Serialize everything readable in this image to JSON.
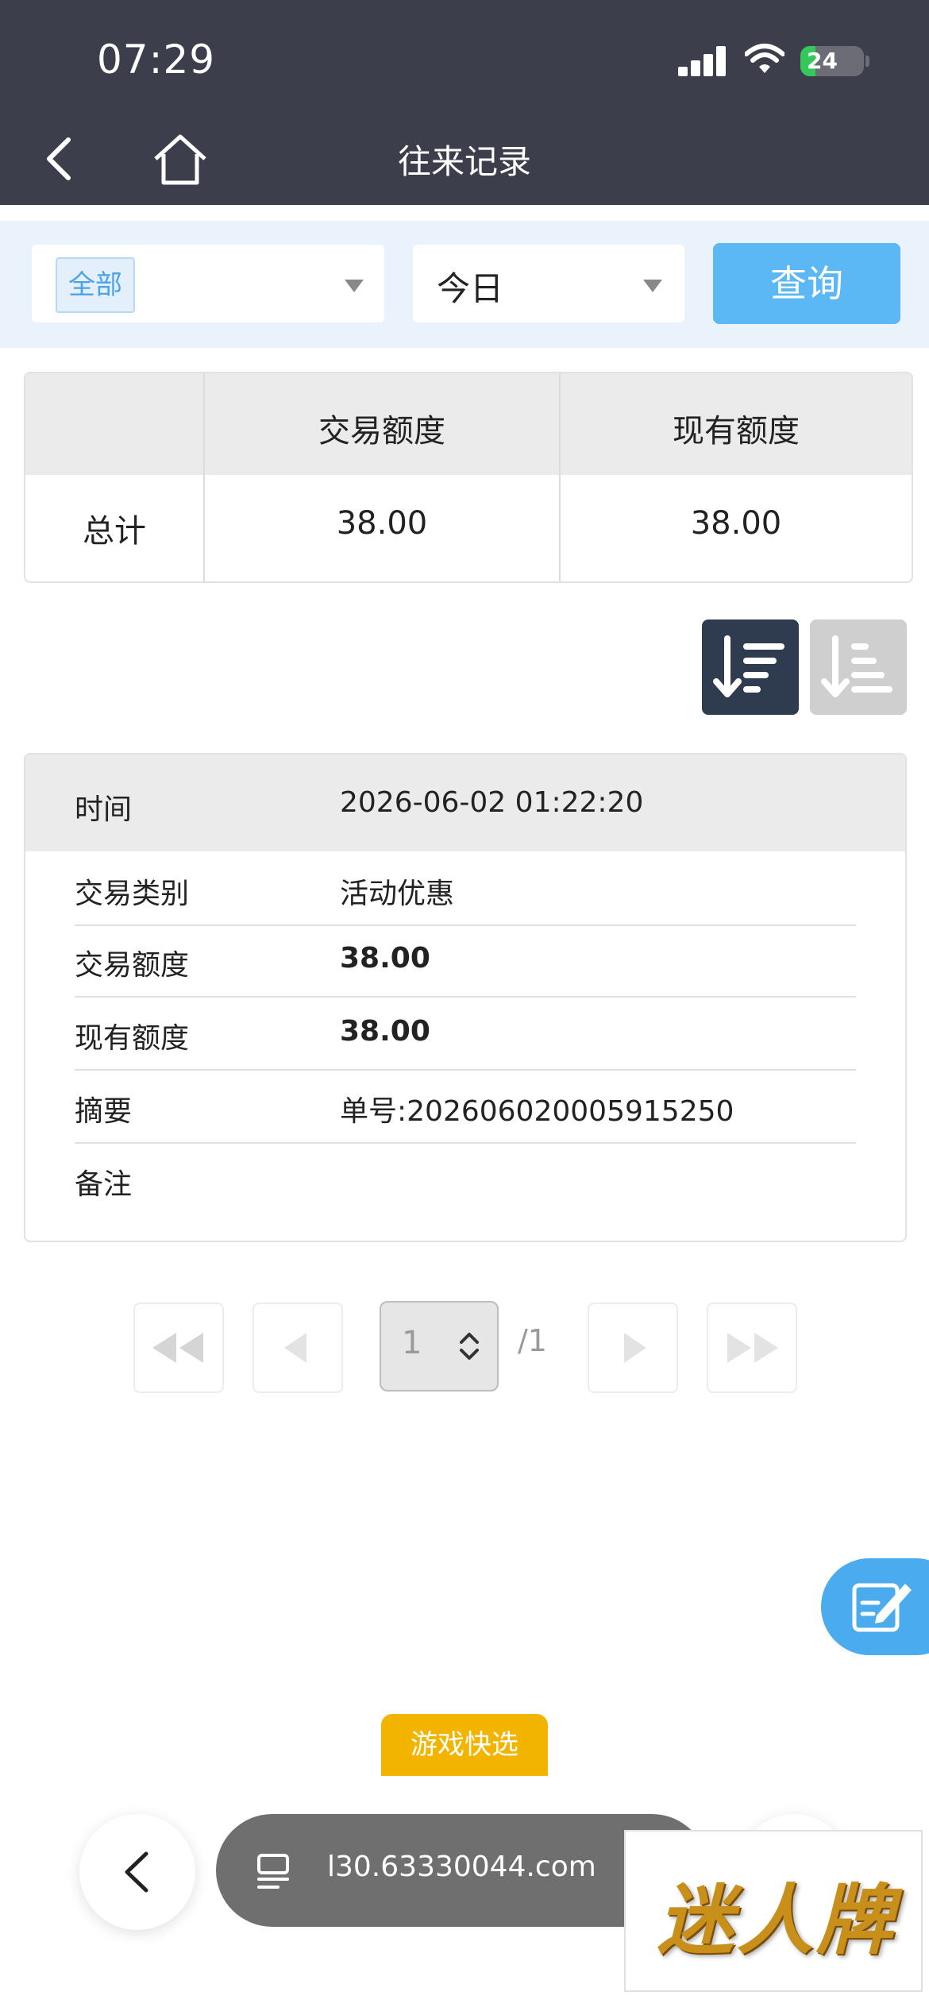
{
  "status_bar": {
    "time": "07:29",
    "battery": "24",
    "battery_level": 0.24
  },
  "nav": {
    "title": "往来记录",
    "back_icon": "chevron-left-icon",
    "home_icon": "home-icon"
  },
  "filters": {
    "category_selected": "全部",
    "period_selected": "今日",
    "query_label": "查询"
  },
  "summary": {
    "headers": [
      "",
      "交易额度",
      "现有额度"
    ],
    "row": {
      "label": "总计",
      "trade_amount": "38.00",
      "current_amount": "38.00"
    }
  },
  "sort": {
    "desc_icon": "sort-descending-icon",
    "asc_icon": "sort-ascending-icon"
  },
  "record": {
    "time_label": "时间",
    "time_value": "2026-06-02 01:22:20",
    "rows": [
      {
        "label": "交易类别",
        "value": "活动优惠"
      },
      {
        "label": "交易额度",
        "value": "38.00"
      },
      {
        "label": "现有额度",
        "value": "38.00"
      },
      {
        "label": "摘要",
        "value": "单号:202606020005915250"
      },
      {
        "label": "备注",
        "value": ""
      }
    ]
  },
  "pagination": {
    "current": "1",
    "total": "/1"
  },
  "game_quick_select": "游戏快选",
  "browser": {
    "url": "l30.63330044.com",
    "tabs_icon": "tabs-icon"
  },
  "brand_logo": "迷人牌",
  "colors": {
    "header_bg": "#3d3e4c",
    "accent": "#5bb8f5",
    "sort_active": "#2f3b4e",
    "game_tab": "#f3b400"
  }
}
